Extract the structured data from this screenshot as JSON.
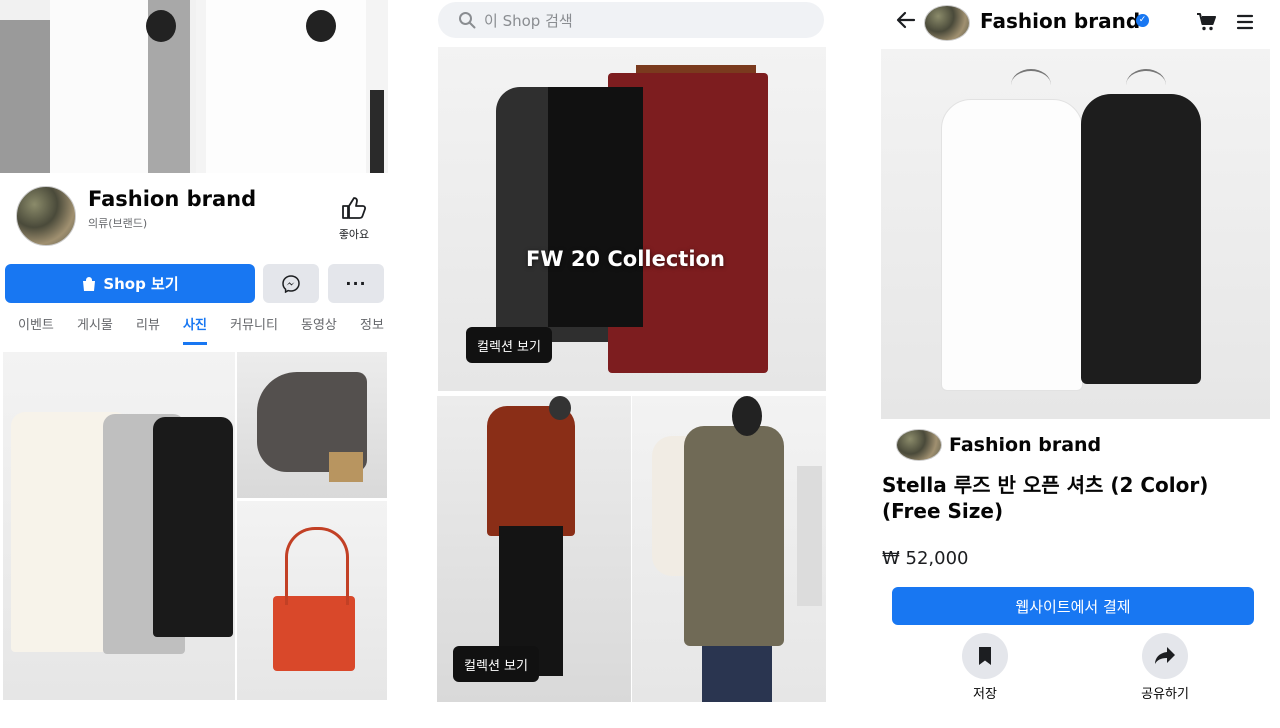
{
  "left": {
    "page_name": "Fashion brand",
    "category": "의류(브랜드)",
    "like_label": "좋아요",
    "shop_button": "Shop 보기",
    "tabs": [
      "이벤트",
      "게시물",
      "리뷰",
      "사진",
      "커뮤니티",
      "동영상",
      "정보"
    ],
    "active_tab": "사진"
  },
  "middle": {
    "search_placeholder": "이 Shop 검색",
    "collection_title": "FW 20 Collection",
    "view_collection_1": "컬렉션 보기",
    "view_collection_2": "컬렉션 보기"
  },
  "right": {
    "header_name": "Fashion brand",
    "shop_name": "Fashion brand",
    "product_title": "Stella 루즈 반 오픈 셔츠 (2 Color) (Free Size)",
    "price": "₩ 52,000",
    "checkout_button": "웹사이트에서 결제",
    "save_label": "저장",
    "share_label": "공유하기"
  },
  "colors": {
    "accent": "#1877f2",
    "muted": "#65676b",
    "button_gray": "#e4e6eb"
  }
}
